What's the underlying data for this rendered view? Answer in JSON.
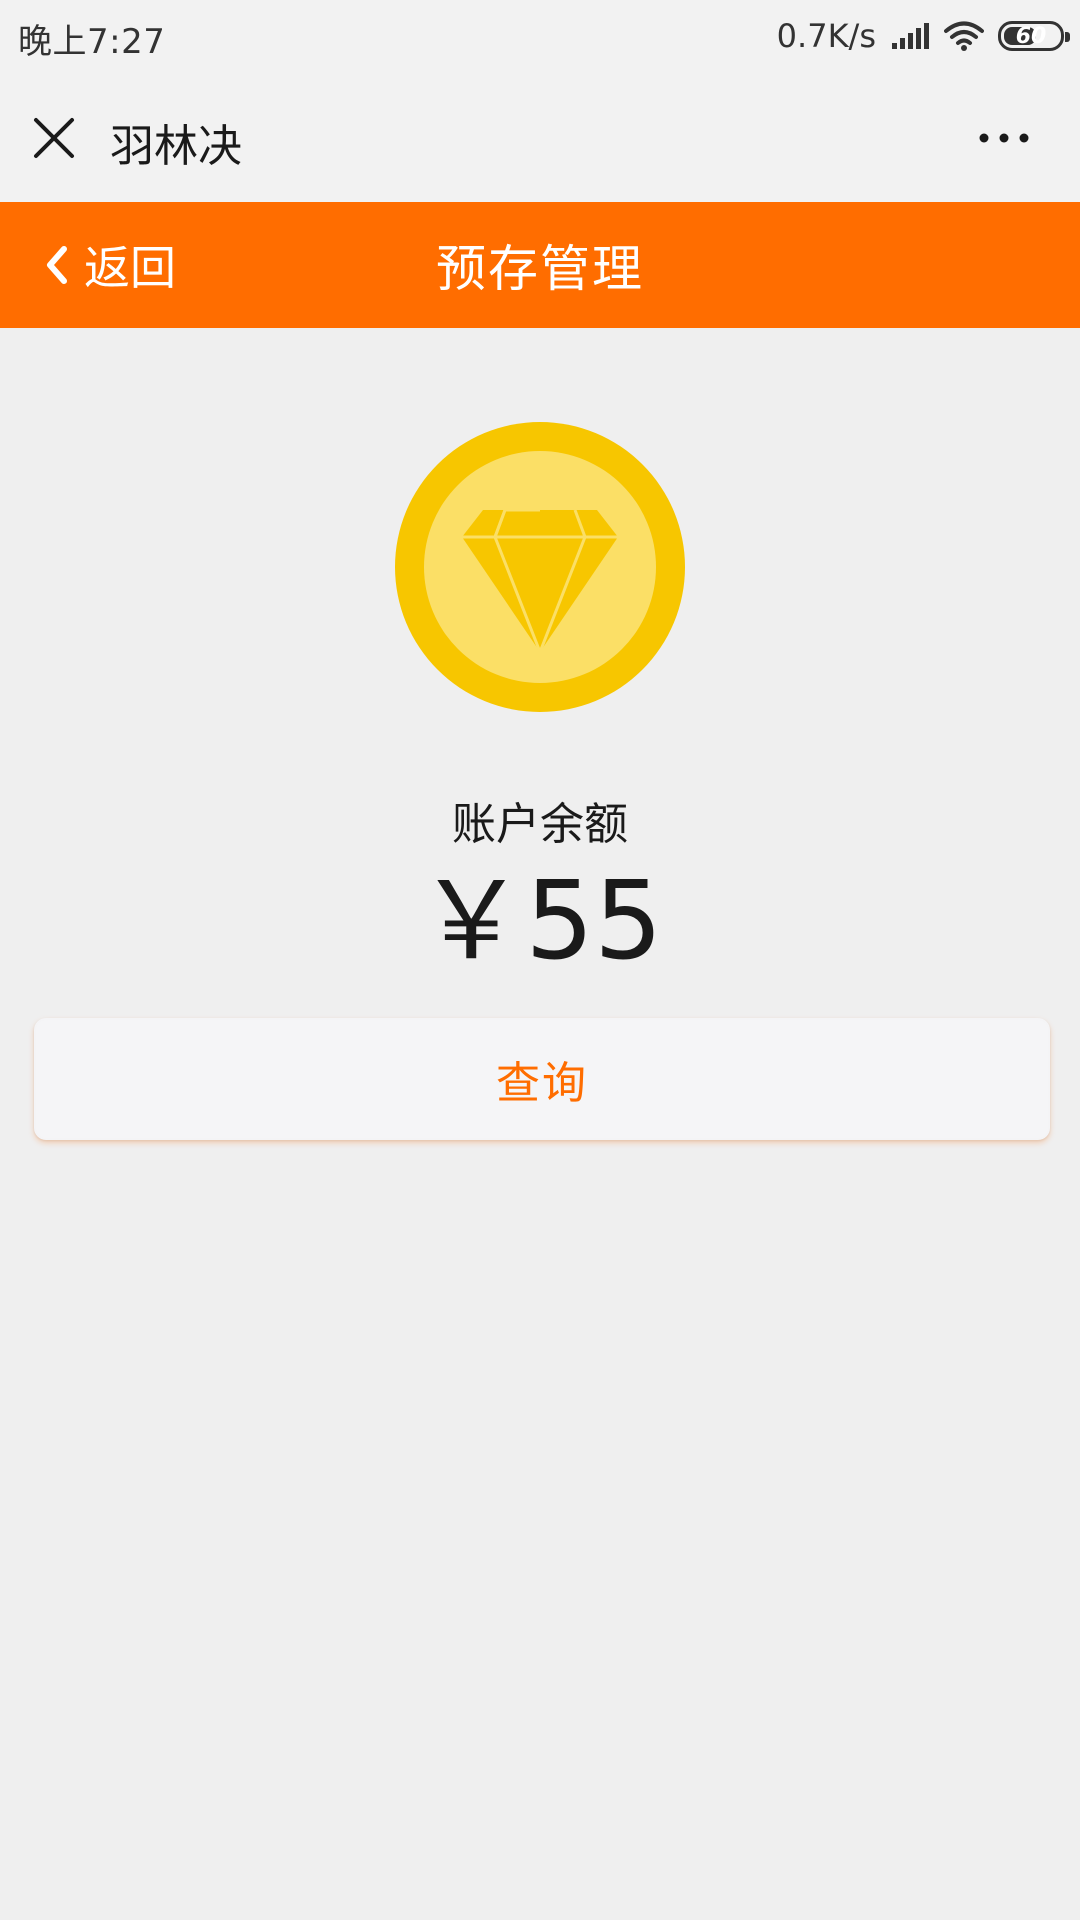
{
  "status_bar": {
    "time": "晚上7:27",
    "net_speed": "0.7K/s",
    "battery": "60",
    "battery_level": 0.6,
    "icons": [
      "signal-icon",
      "wifi-icon",
      "battery-icon"
    ]
  },
  "wx_nav": {
    "title": "羽林决",
    "icons": [
      "close-icon",
      "more-icon"
    ]
  },
  "header": {
    "back_label": "返回",
    "title": "预存管理",
    "background": "#ff6d00",
    "icons": [
      "chevron-left-icon"
    ]
  },
  "balance": {
    "icon": "diamond-coin-icon",
    "label": "账户余额",
    "amount": "￥55"
  },
  "query_button": {
    "label": "查询",
    "color": "#ff6d00"
  }
}
